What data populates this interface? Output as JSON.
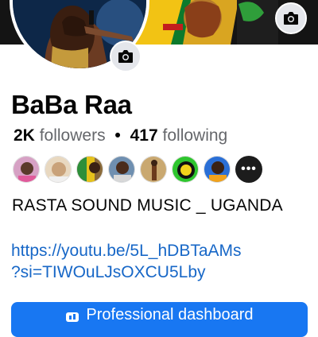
{
  "profile": {
    "name": "BaBa Raa",
    "followers_count": "2K",
    "followers_label": "followers",
    "separator": "•",
    "following_count": "417",
    "following_label": "following",
    "bio": "RASTA SOUND MUSIC _ UGANDA",
    "link_line1": "https://youtu.be/5L_hDBTaAMs",
    "link_line2": "?si=TIWOuLJsOXCU5Lby",
    "link_href": "https://youtu.be/5L_hDBTaAMs?si=TIWOuLJsOXCU5Lby"
  },
  "friends": {
    "more_label": "•••",
    "avatar_colors": [
      "#d6a1c4",
      "#e8d8c0",
      "#8a6a3a",
      "#6f8fb0",
      "#c9a870",
      "#2ec52e",
      "#2a6fd6"
    ]
  },
  "actions": {
    "dashboard_label": "Professional dashboard"
  },
  "icons": {
    "cover_camera": "camera-icon",
    "avatar_camera": "camera-icon",
    "dashboard": "dashboard-icon"
  },
  "colors": {
    "accent": "#1877f2",
    "link": "#1767c7",
    "muted_text": "#65676b"
  }
}
